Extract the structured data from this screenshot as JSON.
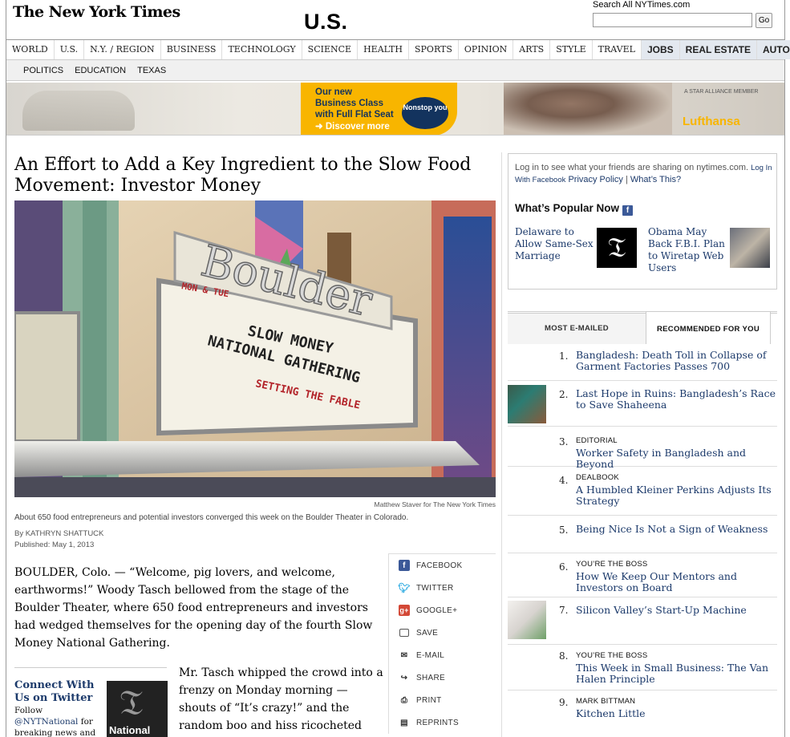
{
  "header": {
    "masthead": "The New York Times",
    "section": "U.S.",
    "search_label": "Search All NYTimes.com",
    "search_placeholder": "",
    "search_button": "Go"
  },
  "nav": {
    "items": [
      "WORLD",
      "U.S.",
      "N.Y. / REGION",
      "BUSINESS",
      "TECHNOLOGY",
      "SCIENCE",
      "HEALTH",
      "SPORTS",
      "OPINION",
      "ARTS",
      "STYLE",
      "TRAVEL"
    ],
    "highlighted": [
      "JOBS",
      "REAL ESTATE",
      "AUTOS"
    ],
    "active": "U.S."
  },
  "subnav": {
    "items": [
      "POLITICS",
      "EDUCATION",
      "TEXAS"
    ]
  },
  "ad": {
    "line1": "Our new",
    "line2": "Business Class",
    "line3": "with Full Flat Seat",
    "cta": "➜ Discover more",
    "badge": "Nonstop you",
    "alliance": "A STAR ALLIANCE MEMBER",
    "brand": "Lufthansa"
  },
  "article": {
    "headline": "An Effort to Add a Key Ingredient to the Slow Food Movement: Investor Money",
    "photo_credit": "Matthew Staver for The New York Times",
    "caption": "About 650 food entrepreneurs and potential investors converged this week on the Boulder Theater in Colorado.",
    "byline": "By KATHRYN SHATTUCK",
    "published": "Published: May 1, 2013",
    "paragraph1": "BOULDER, Colo. — “Welcome, pig lovers, and welcome, earthworms!” Woody Tasch bellowed from the stage of the Boulder Theater, where 650 food entrepreneurs and investors had wedged themselves for the opening day of the fourth Slow Money National Gathering.",
    "paragraph2": "Mr. Tasch whipped the crowd into a frenzy on Monday morning — shouts of “It’s crazy!” and the random boo and hiss ricocheted through the",
    "marquee": {
      "sign": "Boulder",
      "line1": "SLOW MONEY",
      "line2": "NATIONAL GATHERING",
      "line3": "SETTING THE FABLE",
      "side": "MON & TUE"
    }
  },
  "twitter_promo": {
    "heading": "Connect With Us on Twitter",
    "text_prefix": "Follow",
    "handle": "@NYTNational",
    "text_suffix": "for breaking news and",
    "logo_text": "National"
  },
  "share_tools": [
    {
      "label": "FACEBOOK",
      "icon": "facebook-icon"
    },
    {
      "label": "TWITTER",
      "icon": "twitter-icon"
    },
    {
      "label": "GOOGLE+",
      "icon": "google-plus-icon"
    },
    {
      "label": "SAVE",
      "icon": "folder-icon"
    },
    {
      "label": "E-MAIL",
      "icon": "envelope-icon"
    },
    {
      "label": "SHARE",
      "icon": "share-icon"
    },
    {
      "label": "PRINT",
      "icon": "printer-icon"
    },
    {
      "label": "REPRINTS",
      "icon": "reprints-icon"
    }
  ],
  "friends": {
    "text": "Log in to see what your friends are sharing on nytimes.com.",
    "login_link": "Log In With Facebook",
    "privacy_link": "Privacy Policy",
    "separator": "|",
    "whats_this": "What’s This?",
    "popular_heading": "What’s Popular Now",
    "story1": "Delaware to Allow Same-Sex Marriage",
    "story2": "Obama May Back F.B.I. Plan to Wiretap Web Users"
  },
  "tabs": {
    "most_emailed": "MOST E-MAILED",
    "recommended": "RECOMMENDED FOR YOU"
  },
  "recommended": [
    {
      "num": "1.",
      "kicker": "",
      "title": "Bangladesh: Death Toll in Collapse of Garment Factories Passes 700"
    },
    {
      "num": "2.",
      "kicker": "",
      "title": "Last Hope in Ruins: Bangladesh’s Race to Save Shaheena"
    },
    {
      "num": "3.",
      "kicker": "EDITORIAL",
      "title": "Worker Safety in Bangladesh and Beyond"
    },
    {
      "num": "4.",
      "kicker": "DEALBOOK",
      "title": "A Humbled Kleiner Perkins Adjusts Its Strategy"
    },
    {
      "num": "5.",
      "kicker": "",
      "title": "Being Nice Is Not a Sign of Weakness"
    },
    {
      "num": "6.",
      "kicker": "YOU’RE THE BOSS",
      "title": "How We Keep Our Mentors and Investors on Board"
    },
    {
      "num": "7.",
      "kicker": "",
      "title": "Silicon Valley’s Start-Up Machine"
    },
    {
      "num": "8.",
      "kicker": "YOU’RE THE BOSS",
      "title": "This Week in Small Business: The Van Halen Principle"
    },
    {
      "num": "9.",
      "kicker": "MARK BITTMAN",
      "title": "Kitchen Little"
    }
  ]
}
